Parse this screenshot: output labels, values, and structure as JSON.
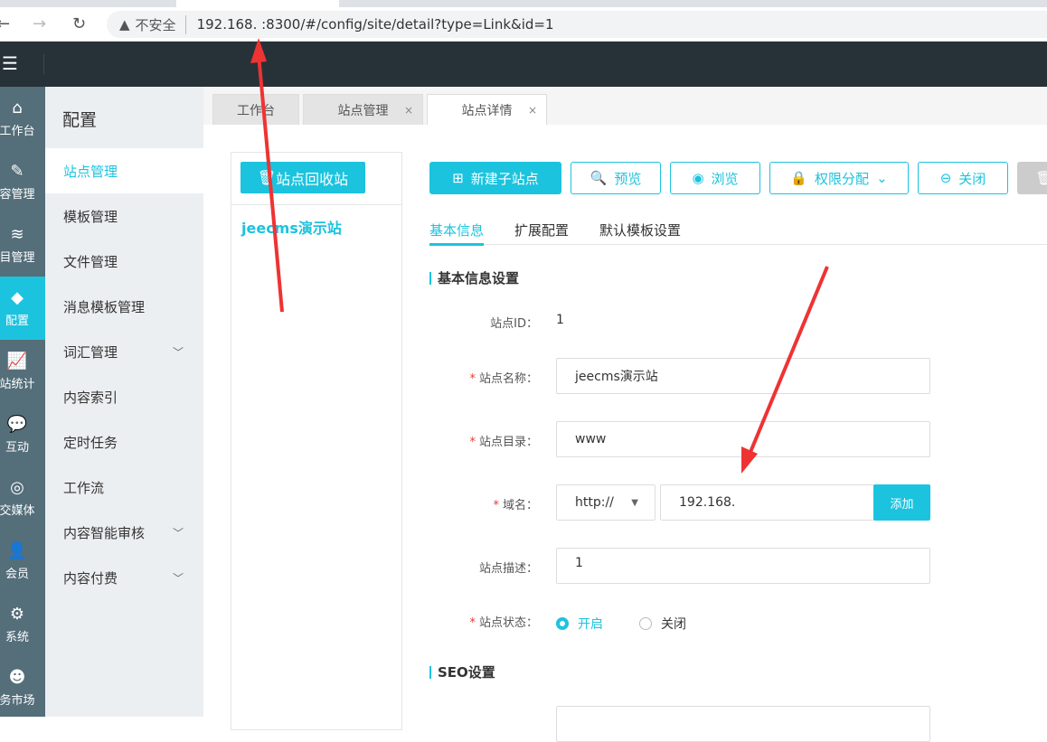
{
  "browser": {
    "insecure_label": "不安全",
    "url": "192.168.   :8300/#/config/site/detail?type=Link&id=1"
  },
  "iconbar": [
    {
      "icon": "home",
      "label": "工作台"
    },
    {
      "icon": "edit",
      "label": "容管理"
    },
    {
      "icon": "layers",
      "label": "目管理"
    },
    {
      "icon": "cube",
      "label": "配置",
      "active": true
    },
    {
      "icon": "chart",
      "label": "站统计"
    },
    {
      "icon": "chat",
      "label": "互动"
    },
    {
      "icon": "media",
      "label": "交媒体"
    },
    {
      "icon": "user",
      "label": "会员"
    },
    {
      "icon": "gear",
      "label": "系统"
    },
    {
      "icon": "market",
      "label": "务市场"
    }
  ],
  "submenu": {
    "title": "配置",
    "items": [
      {
        "label": "站点管理",
        "active": true
      },
      {
        "label": "模板管理"
      },
      {
        "label": "文件管理"
      },
      {
        "label": "消息模板管理"
      },
      {
        "label": "词汇管理",
        "chevron": true
      },
      {
        "label": "内容索引"
      },
      {
        "label": "定时任务"
      },
      {
        "label": "工作流"
      },
      {
        "label": "内容智能审核",
        "chevron": true
      },
      {
        "label": "内容付费",
        "chevron": true
      }
    ]
  },
  "tabs": [
    {
      "label": "工作台"
    },
    {
      "label": "站点管理",
      "close": "×"
    },
    {
      "label": "站点详情",
      "close": "×"
    }
  ],
  "left_panel": {
    "recycle": "站点回收站",
    "site": "jeecms演示站"
  },
  "toolbar": {
    "new_sub": "新建子站点",
    "preview": "预览",
    "browse": "浏览",
    "permission": "权限分配",
    "close": "关闭"
  },
  "form_tabs": [
    "基本信息",
    "扩展配置",
    "默认模板设置"
  ],
  "section1": "基本信息设置",
  "fields": {
    "id_label": "站点ID：",
    "id_value": "1",
    "name_label": "站点名称：",
    "name_value": "jeecms演示站",
    "dir_label": "站点目录：",
    "dir_value": "www",
    "domain_label": "域名：",
    "protocol": "http://",
    "domain_value": "192.168.",
    "add": "添加",
    "desc_label": "站点描述：",
    "desc_value": "1",
    "status_label": "站点状态：",
    "status_on": "开启",
    "status_off": "关闭",
    "required": "*"
  },
  "section2": "SEO设置"
}
